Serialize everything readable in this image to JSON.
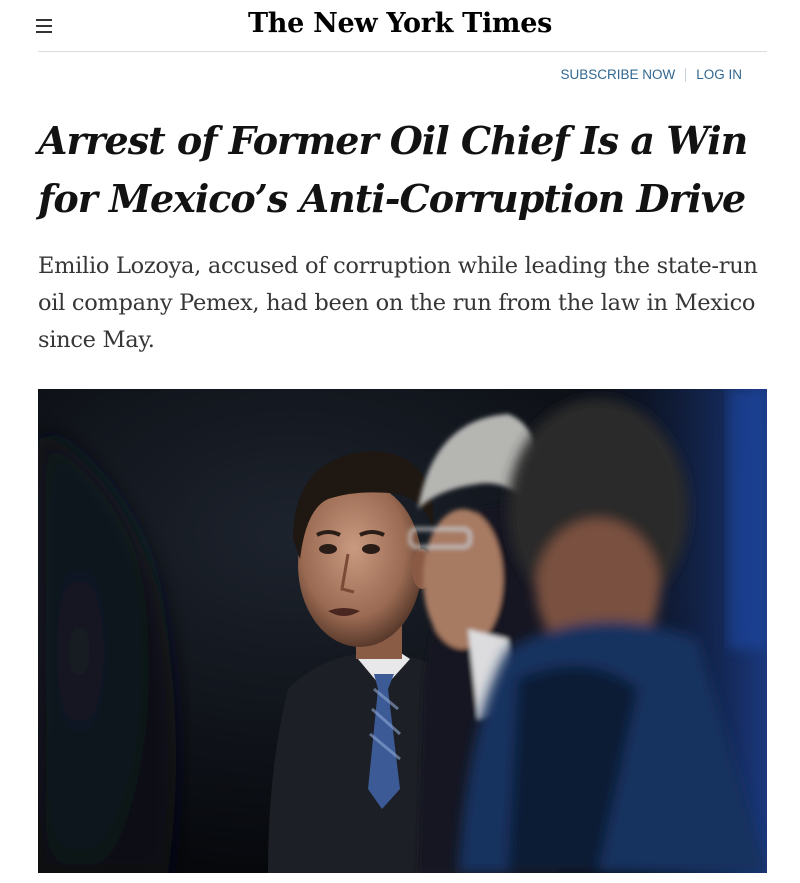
{
  "header": {
    "menu_icon": "hamburger-menu-icon",
    "masthead": "The New York Times",
    "subscribe_label": "SUBSCRIBE NOW",
    "login_label": "LOG IN",
    "link_color": "#326891"
  },
  "article": {
    "headline": "Arrest of Former Oil Chief Is a Win for Mexico’s Anti-Corruption Drive",
    "summary": "Emilio Lozoya, accused of corruption while leading the state-run oil company Pemex, had been on the run from the law in Mexico since May."
  }
}
